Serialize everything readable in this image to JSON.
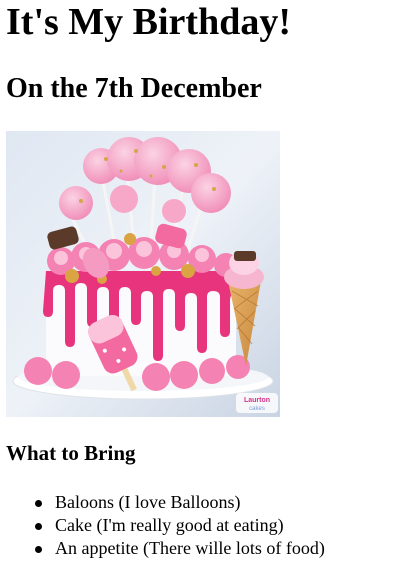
{
  "header": {
    "title": "It's My Birthday!",
    "subtitle": "On the 7th December"
  },
  "hero_image": {
    "icon": "birthday-cake-image",
    "watermark": "Laurton Cakes"
  },
  "bring_section": {
    "heading": "What to Bring",
    "items": [
      {
        "label": "Baloons (I love Balloons)"
      },
      {
        "label": "Cake (I'm really good at eating)"
      },
      {
        "label": "An appetite (There wille lots of food)"
      }
    ]
  },
  "colors": {
    "text": "#000000",
    "background": "#ffffff",
    "cake_pink": "#e8347d",
    "frosting_light": "#f7b6cf"
  }
}
